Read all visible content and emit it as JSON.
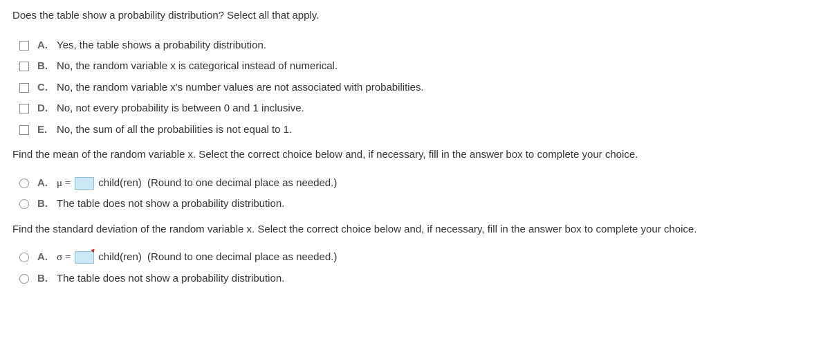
{
  "question1": {
    "prompt": "Does the table show a probability distribution? Select all that apply.",
    "options": [
      {
        "letter": "A.",
        "text": "Yes, the table shows a probability distribution."
      },
      {
        "letter": "B.",
        "text": "No, the random variable x is categorical instead of numerical."
      },
      {
        "letter": "C.",
        "text": "No, the random variable x's number values are not associated with probabilities."
      },
      {
        "letter": "D.",
        "text": "No, not every probability is between 0 and 1 inclusive."
      },
      {
        "letter": "E.",
        "text": "No, the sum of all the probabilities is not equal to 1."
      }
    ]
  },
  "question2": {
    "prompt": "Find the mean of the random variable x. Select the correct choice below and, if necessary, fill in the answer box to complete your choice.",
    "options": [
      {
        "letter": "A.",
        "symbol": "μ =",
        "unit": "child(ren)",
        "hint": "(Round to one decimal place as needed.)"
      },
      {
        "letter": "B.",
        "text": "The table does not show a probability distribution."
      }
    ]
  },
  "question3": {
    "prompt": "Find the standard deviation of the random variable x. Select the correct choice below and, if necessary, fill in the answer box to complete your choice.",
    "options": [
      {
        "letter": "A.",
        "symbol": "σ =",
        "unit": "child(ren)",
        "hint": "(Round to one decimal place as needed.)"
      },
      {
        "letter": "B.",
        "text": "The table does not show a probability distribution."
      }
    ]
  }
}
